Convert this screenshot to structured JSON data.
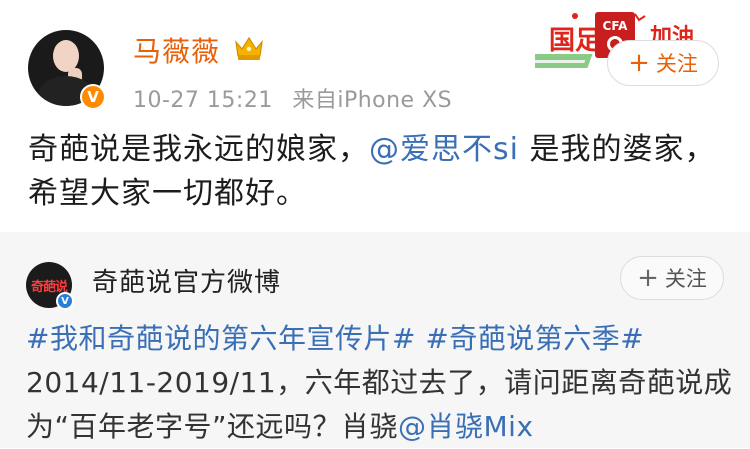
{
  "post": {
    "username": "马薇薇",
    "time": "10-27 15:21",
    "source": "来自iPhone XS",
    "follow_label": "关注",
    "text_before": "奇葩说是我永远的娘家，",
    "mention": "@爱思不si",
    "text_after": " 是我的婆家，希望大家一切都好。",
    "promo_text_1": "国足",
    "promo_text_2": "加油",
    "promo_badge": "CFA"
  },
  "repost": {
    "username": "奇葩说官方微博",
    "follow_label": "关注",
    "tag_1": "#我和奇葩说的第六年宣传片#",
    "tag_2": "#奇葩说第六季#",
    "text": " 2014/11-2019/11，六年都过去了，请问距离奇葩说成为“百年老字号”还远吗？肖骁",
    "mention": "@肖骁Mix",
    "avatar_text": "奇葩说"
  },
  "colors": {
    "username_orange": "#e8600a",
    "link_blue": "#3a6fb6",
    "repost_bg": "#f6f6f6"
  }
}
